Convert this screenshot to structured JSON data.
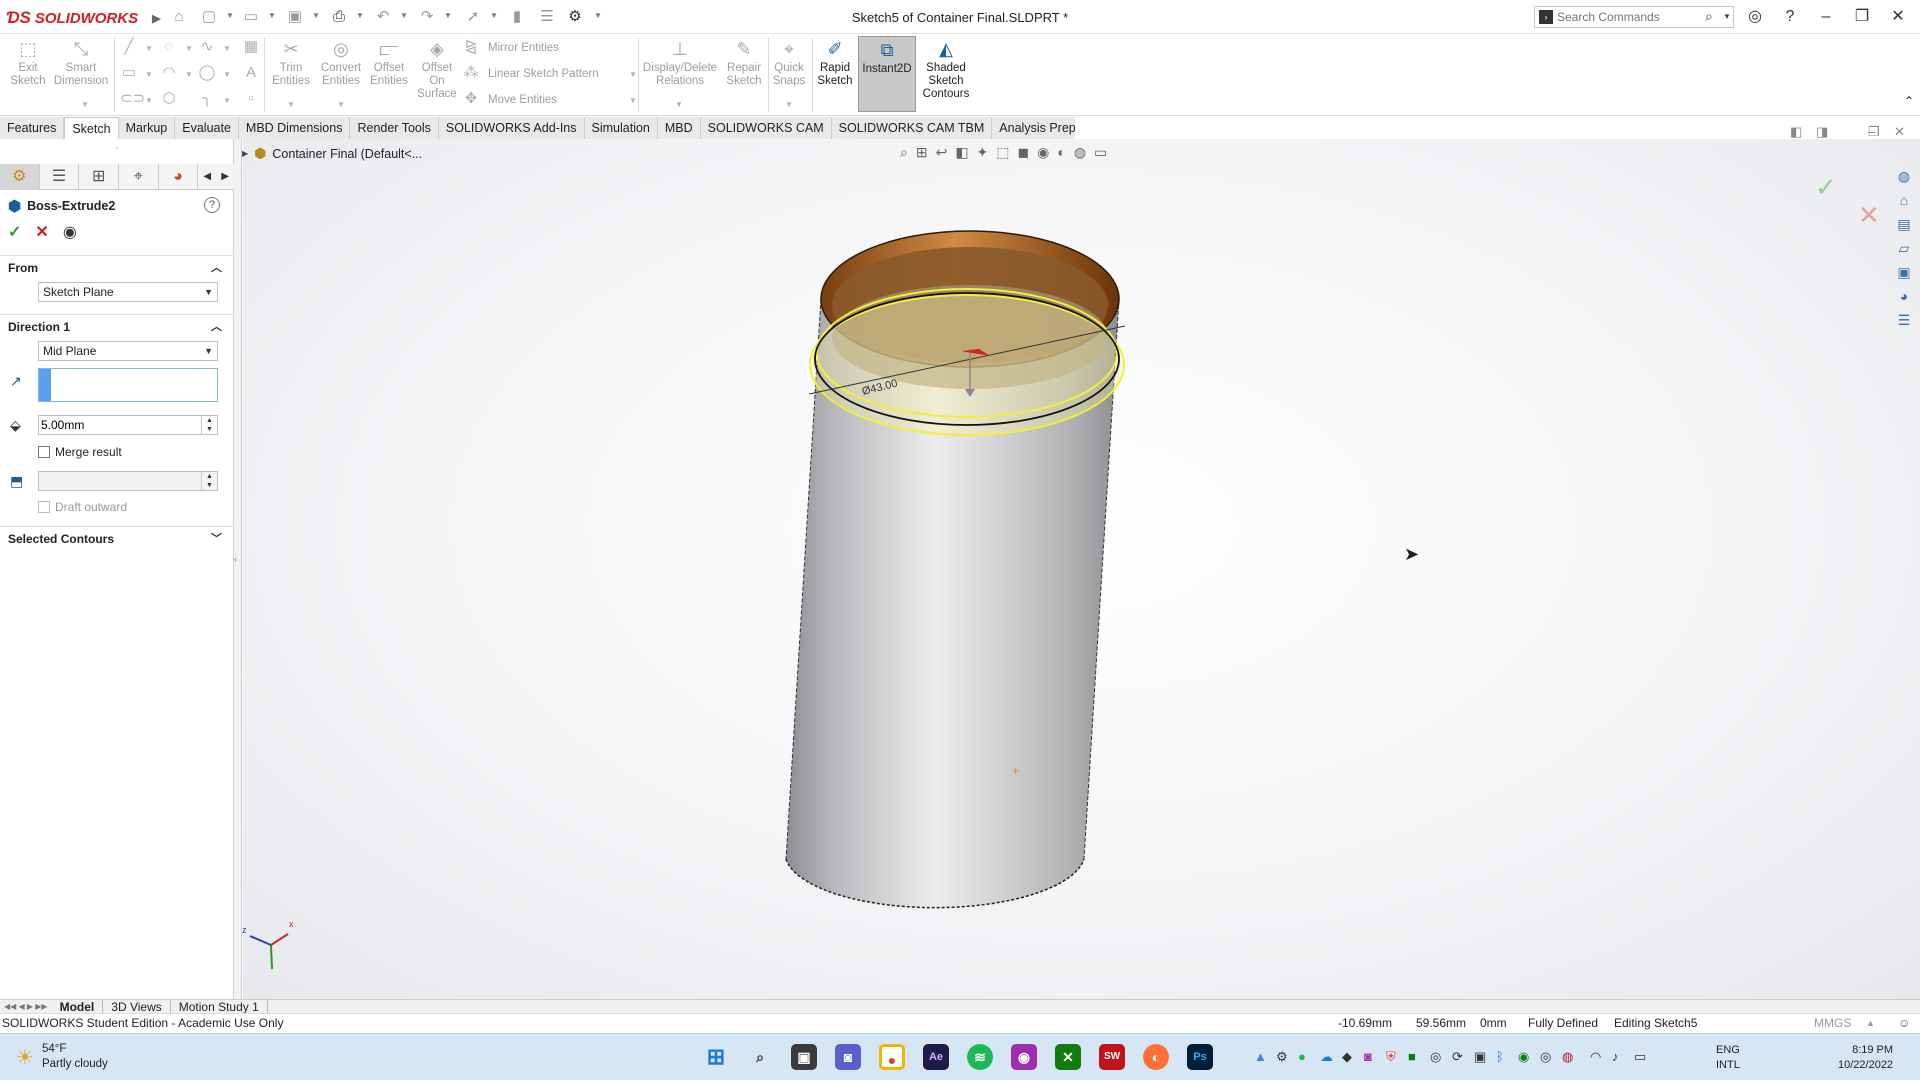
{
  "app": {
    "brand": "SOLIDWORKS",
    "doc_title": "Sketch5 of Container Final.SLDPRT *"
  },
  "search": {
    "placeholder": "Search Commands"
  },
  "commands": {
    "exit_sketch": "Exit Sketch",
    "smart_dimension": "Smart Dimension",
    "trim_entities": "Trim Entities",
    "convert_entities": "Convert Entities",
    "offset_entities": "Offset Entities",
    "offset_on_surface": "Offset On Surface",
    "mirror_entities": "Mirror Entities",
    "linear_sketch_pattern": "Linear Sketch Pattern",
    "move_entities": "Move Entities",
    "display_delete_relations": "Display/Delete Relations",
    "repair_sketch": "Repair Sketch",
    "quick_snaps": "Quick Snaps",
    "rapid_sketch": "Rapid Sketch",
    "instant2d": "Instant2D",
    "shaded_sketch_contours": "Shaded Sketch Contours"
  },
  "tabs": [
    "Features",
    "Sketch",
    "Markup",
    "Evaluate",
    "MBD Dimensions",
    "Render Tools",
    "SOLIDWORKS Add-Ins",
    "Simulation",
    "MBD",
    "SOLIDWORKS CAM",
    "SOLIDWORKS CAM TBM",
    "Analysis Preparation"
  ],
  "active_tab": "Sketch",
  "property_manager": {
    "title": "Boss-Extrude2",
    "from_label": "From",
    "from_value": "Sketch Plane",
    "direction1_label": "Direction 1",
    "end_condition": "Mid Plane",
    "depth": "5.00mm",
    "merge_result": "Merge result",
    "draft_outward": "Draft outward",
    "selected_contours": "Selected Contours"
  },
  "tree": {
    "root": "Container Final  (Default<..."
  },
  "model": {
    "dimension_label": "Ø43.00"
  },
  "bottom_tabs": [
    "Model",
    "3D Views",
    "Motion Study 1"
  ],
  "status": {
    "edition": "SOLIDWORKS Student Edition - Academic Use Only",
    "x": "-10.69mm",
    "y": "59.56mm",
    "z": "0mm",
    "defined": "Fully Defined",
    "editing": "Editing Sketch5",
    "units": "MMGS"
  },
  "taskbar": {
    "temp": "54°F",
    "weather": "Partly cloudy",
    "lang1": "ENG",
    "lang2": "INTL",
    "time": "8:19 PM",
    "date": "10/22/2022"
  },
  "colors": {
    "brand_red": "#d11d24",
    "ok_green": "#2f9a2f",
    "cancel_red": "#d21d1d",
    "selection_yellow": "#f2ef3a",
    "rim_orange": "#b8661f"
  }
}
